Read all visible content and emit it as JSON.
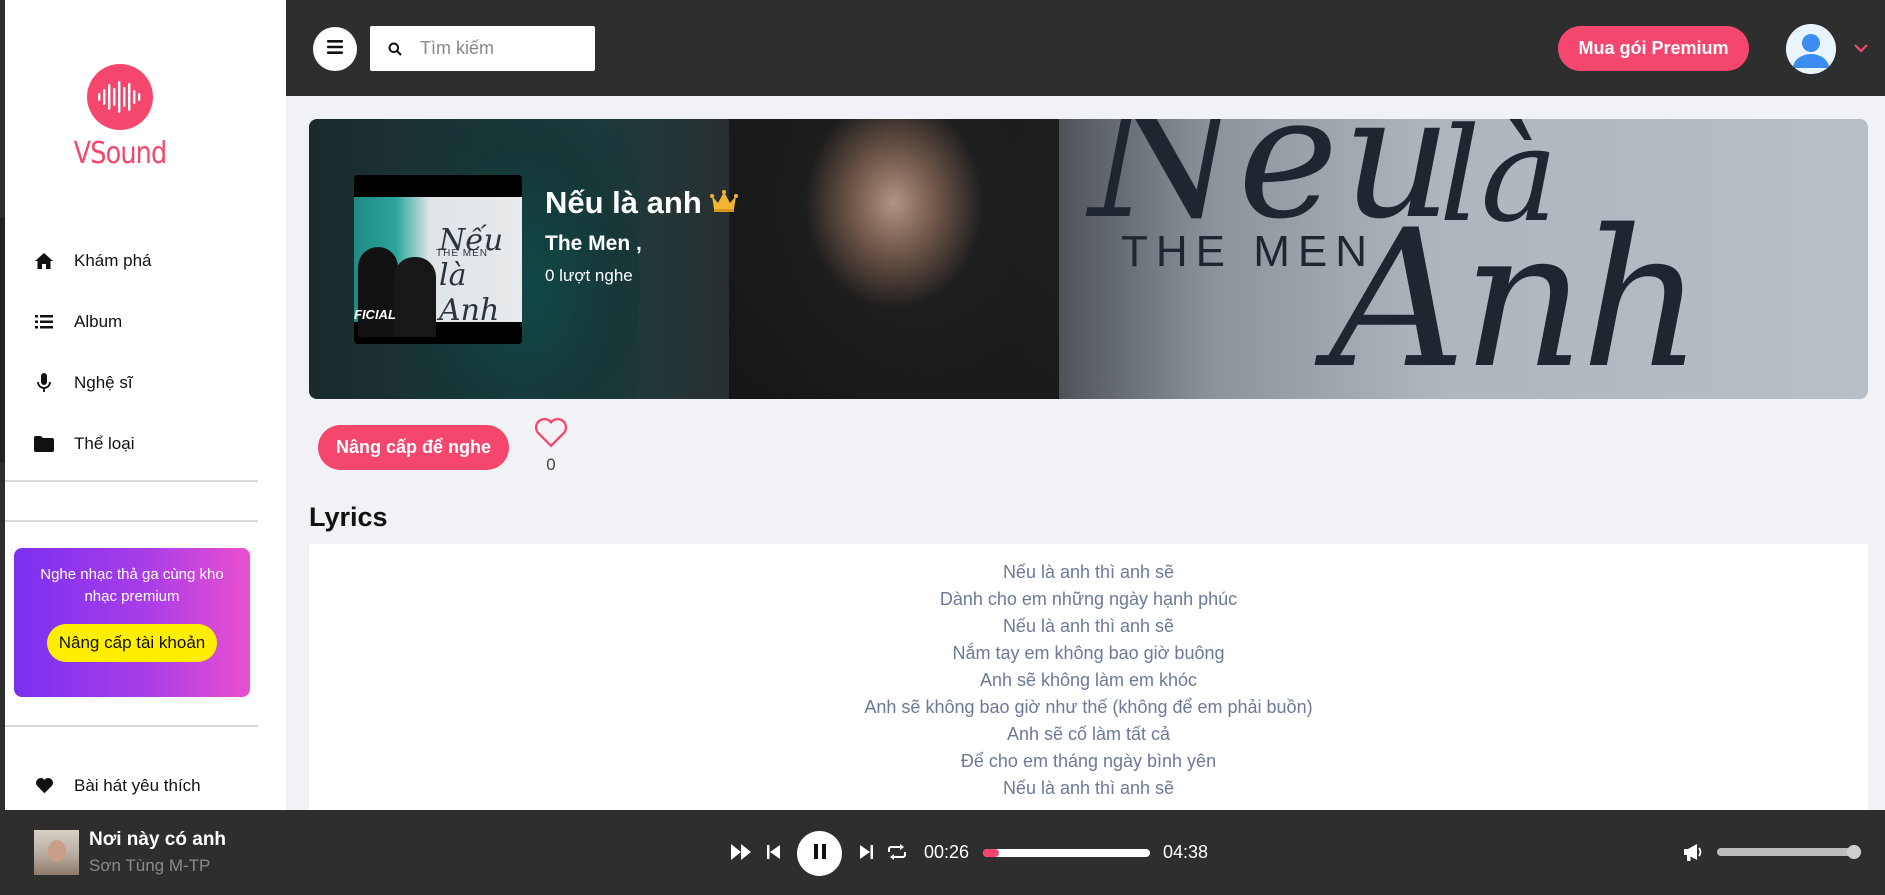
{
  "app": {
    "name": "VSound",
    "brand_color": "#f5476e"
  },
  "sidebar": {
    "items": [
      {
        "label": "Khám phá",
        "icon": "home-icon"
      },
      {
        "label": "Album",
        "icon": "list-icon"
      },
      {
        "label": "Nghệ sĩ",
        "icon": "microphone-icon"
      },
      {
        "label": "Thể loại",
        "icon": "folder-icon"
      }
    ],
    "promo": {
      "text": "Nghe nhạc thả ga cùng kho nhạc premium",
      "button": "Nâng cấp tài khoản"
    },
    "favorites": {
      "label": "Bài hát yêu thích",
      "icon": "heart-icon"
    }
  },
  "header": {
    "search_placeholder": "Tìm kiếm",
    "premium_button": "Mua gói Premium"
  },
  "song": {
    "title": "Nếu là anh",
    "artist": "The Men ,",
    "plays": "0 lượt nghe",
    "upgrade_button": "Nâng cấp để nghe",
    "likes": "0",
    "cover_text": {
      "title": "Nếu là Anh",
      "band": "THE MEN",
      "tag": "FICIAL"
    }
  },
  "lyrics": {
    "heading": "Lyrics",
    "lines": [
      "Nếu là anh thì anh sẽ",
      "Dành cho em những ngày hạnh phúc",
      "Nếu là anh thì anh sẽ",
      "Nắm tay em không bao giờ buông",
      "Anh sẽ không làm em khóc",
      "Anh sẽ không bao giờ như thế (không để em phải buồn)",
      "Anh sẽ cố làm tất cả",
      "Để cho em tháng ngày bình yên",
      "Nếu là anh thì anh sẽ"
    ]
  },
  "player": {
    "title": "Nơi này có anh",
    "artist": "Sơn Tùng M-TP",
    "current_time": "00:26",
    "total_time": "04:38",
    "progress": 0.094,
    "volume": 0.95
  }
}
